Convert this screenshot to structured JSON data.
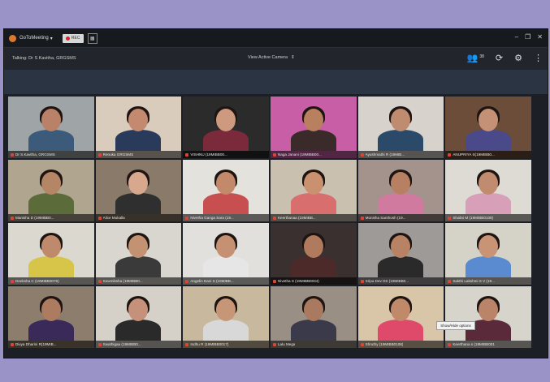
{
  "window": {
    "app_name": "GoToMeeting",
    "rec_label": "REC",
    "talking": "Talking: Dr S Kavitha, GRGSMS",
    "view_mode": "View Active Camera",
    "people_count": "38",
    "tooltip": "Show/Hide options"
  },
  "participants": [
    {
      "name": "Dr S.Kavitha, GRGSMS",
      "wall": "#9fa4a6",
      "shirt": "#3c5a7a",
      "skin": "#b98168"
    },
    {
      "name": "Renuka GRGSMS",
      "wall": "#d9ccbc",
      "shirt": "#2a3a5a",
      "skin": "#c38a70"
    },
    {
      "name": "VISHNU (19MIBB00...",
      "wall": "#2b2b2b",
      "shirt": "#7a2a3a",
      "skin": "#cd9a7f"
    },
    {
      "name": "Naga Janani (19MIBB00...",
      "wall": "#c85fa6",
      "shirt": "#3b2a2a",
      "skin": "#b9805f"
    },
    {
      "name": "Ayushmathi R (19MIB...",
      "wall": "#d7d3cc",
      "shirt": "#2b4a6a",
      "skin": "#c08c70"
    },
    {
      "name": "ANUPRIYA S(19MIBB0...",
      "wall": "#6b4d3a",
      "shirt": "#4a4a8a",
      "skin": "#c59176"
    },
    {
      "name": "Manisha D (19MIBB0...",
      "wall": "#b0a58f",
      "shirt": "#5b6b3a",
      "skin": "#b58666"
    },
    {
      "name": "Alice Mukalla",
      "wall": "#8a7a6a",
      "shirt": "#2f2f2f",
      "skin": "#d7a88e"
    },
    {
      "name": "Nivetha Ganga Sara (19...",
      "wall": "#e4e2dc",
      "shirt": "#c74f4f",
      "skin": "#c28a6b"
    },
    {
      "name": "Keerthanaa (19MIBB...",
      "wall": "#c9c0b0",
      "shirt": "#d86e6e",
      "skin": "#c9916f"
    },
    {
      "name": "Monisha Santhosh (19...",
      "wall": "#a4928c",
      "shirt": "#d07aa0",
      "skin": "#b88063"
    },
    {
      "name": "Shalini M (19MIBB0108)",
      "wall": "#dedbd4",
      "shirt": "#d89fb8",
      "skin": "#c08b6e"
    },
    {
      "name": "Deeksha C (19MIBB0076)",
      "wall": "#dad8cf",
      "shirt": "#d7c54a",
      "skin": "#bf8a6c"
    },
    {
      "name": "Sowmiksha (19MIBB0...",
      "wall": "#d9d6cf",
      "shirt": "#3a3a3a",
      "skin": "#c39273"
    },
    {
      "name": "Angelin Dani S (19MIBB...",
      "wall": "#e2e0dc",
      "shirt": "#e6e6e6",
      "skin": "#c69072"
    },
    {
      "name": "Nivetha S (19MIBB0034)",
      "wall": "#3a3030",
      "shirt": "#4d2a2a",
      "skin": "#b07a5e"
    },
    {
      "name": "Sripa Dev DS (19MIBB0...",
      "wall": "#9e9a98",
      "shirt": "#2a2a2a",
      "skin": "#b88365"
    },
    {
      "name": "Sakthi Lakshmi S V (19...",
      "wall": "#d5d3c7",
      "shirt": "#5a8ad0",
      "skin": "#c99376"
    },
    {
      "name": "Divya Dharini R(19MIB...",
      "wall": "#8c7d6d",
      "shirt": "#3a2a5a",
      "skin": "#ad7b60"
    },
    {
      "name": "Swathigaa (19MIBB0...",
      "wall": "#d6d1c8",
      "shirt": "#2a2a2a",
      "skin": "#c5917a"
    },
    {
      "name": "Indhu R (19MIBB0017)",
      "wall": "#c8b89e",
      "shirt": "#d8d8d8",
      "skin": "#c79676"
    },
    {
      "name": "Lalu Mega",
      "wall": "#9a8f84",
      "shirt": "#3a3a4a",
      "skin": "#a97a5f"
    },
    {
      "name": "Shruthy (19MIBB0108)",
      "wall": "#d9c6a8",
      "shirt": "#e04a6a",
      "skin": "#c08a6a"
    },
    {
      "name": "Keerthana s (19MIBB001",
      "wall": "#d7d4cc",
      "shirt": "#5a2a3a",
      "skin": "#b98467"
    }
  ],
  "icons": {
    "people": "people-icon",
    "refresh": "refresh-icon",
    "settings": "gear-icon",
    "more": "more-icon"
  }
}
